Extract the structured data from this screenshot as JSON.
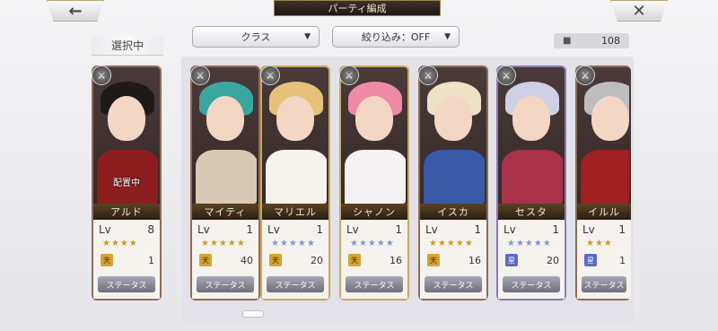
{
  "header": {
    "title": "パーティ編成",
    "back_icon": "←",
    "close_icon": "✕"
  },
  "selected_label": "選択中",
  "filters": {
    "class_label": "クラス",
    "filter_label": "絞り込み：OFF",
    "arrow": "▼"
  },
  "unit_count": {
    "icon": "person-icon",
    "value": "108"
  },
  "cards": [
    {
      "name": "アルド",
      "lv_label": "Lv",
      "lv": "8",
      "stars": "★★★★",
      "star_color": "gold",
      "rank": "天",
      "cost": "1",
      "status": "ステータス",
      "deployed": "配置中",
      "frame": "brown",
      "hair": "#1e1a1a",
      "body": "#8c1e1e"
    },
    {
      "name": "マイティ",
      "lv_label": "Lv",
      "lv": "1",
      "stars": "★★★★★",
      "star_color": "gold",
      "rank": "天",
      "cost": "40",
      "status": "ステータス",
      "deployed": "",
      "frame": "brown",
      "hair": "#3aa6a0",
      "body": "#d8c9b4"
    },
    {
      "name": "マリエル",
      "lv_label": "Lv",
      "lv": "1",
      "stars": "★★★★★",
      "star_color": "blue",
      "rank": "天",
      "cost": "20",
      "status": "ステータス",
      "deployed": "",
      "frame": "gold",
      "hair": "#e6c27a",
      "body": "#f6f2ec"
    },
    {
      "name": "シャノン",
      "lv_label": "Lv",
      "lv": "1",
      "stars": "★★★★★",
      "star_color": "blue",
      "rank": "天",
      "cost": "16",
      "status": "ステータス",
      "deployed": "",
      "frame": "gold",
      "hair": "#ef8aa6",
      "body": "#f4f2f2"
    },
    {
      "name": "イスカ",
      "lv_label": "Lv",
      "lv": "1",
      "stars": "★★★★★",
      "star_color": "gold",
      "rank": "天",
      "cost": "16",
      "status": "ステータス",
      "deployed": "",
      "frame": "brown",
      "hair": "#efe2c4",
      "body": "#3a5aa8"
    },
    {
      "name": "セスタ",
      "lv_label": "Lv",
      "lv": "1",
      "stars": "★★★★★",
      "star_color": "blue",
      "rank": "星",
      "cost": "20",
      "status": "ステータス",
      "deployed": "",
      "frame": "purple",
      "hair": "#cfd0e6",
      "body": "#a8324a"
    },
    {
      "name": "イルル",
      "lv_label": "Lv",
      "lv": "1",
      "stars": "★★★",
      "star_color": "gold",
      "rank": "星",
      "cost": "1",
      "status": "ステータス",
      "deployed": "",
      "frame": "brown",
      "hair": "#bdbdbd",
      "body": "#a02020"
    }
  ]
}
